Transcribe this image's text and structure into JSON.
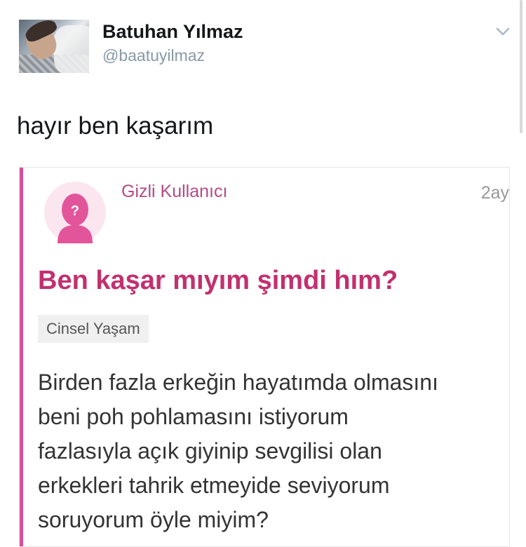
{
  "tweet": {
    "display_name": "Batuhan Yılmaz",
    "handle": "@baatuyilmaz",
    "text": "hayır ben kaşarım"
  },
  "quoted_post": {
    "author": "Gizli Kullanıcı",
    "time": "2ay",
    "title": "Ben kaşar mıyım şimdi hım?",
    "category": "Cinsel Yaşam",
    "body_lines": [
      "Birden fazla erkeğin hayatımda olmasını",
      "beni poh pohlamasını istiyorum",
      "fazlasıyla açık giyinip sevgilisi olan",
      "erkekleri tahrik etmeyide seviyorum",
      "soruyorum öyle miyim?"
    ],
    "accent_color": "#d94f9a"
  },
  "icons": {
    "menu": "chevron-down-icon",
    "anonymous_user": "anonymous-user-icon"
  }
}
